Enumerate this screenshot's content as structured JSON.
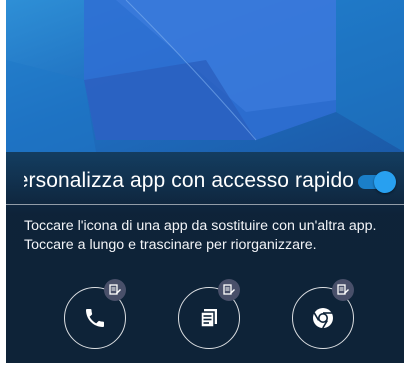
{
  "quick_access": {
    "title": "Personalizza app con accesso rapido",
    "toggle_state": "on",
    "instructions": [
      "Toccare l'icona di una app da sostituire con un'altra app.",
      "Toccare a lungo e trascinare per riorganizzare."
    ],
    "apps": [
      {
        "icon": "phone-icon",
        "edit_icon": "edit-icon"
      },
      {
        "icon": "notes-icon",
        "edit_icon": "edit-icon"
      },
      {
        "icon": "chrome-icon",
        "edit_icon": "edit-icon"
      }
    ]
  },
  "colors": {
    "accent": "#28a0f0",
    "panel_background": "#0e2338",
    "wallpaper": "#1f6fc0"
  }
}
